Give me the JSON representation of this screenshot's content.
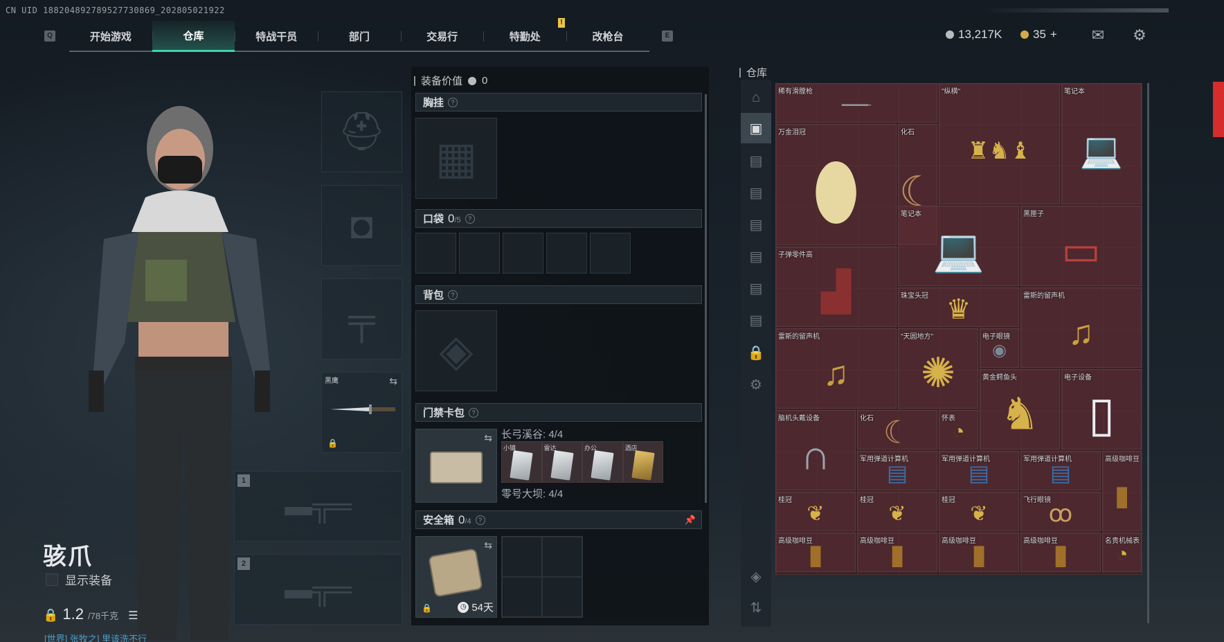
{
  "uid": "CN UID 1882048927895277308​69_202805021922",
  "nav": {
    "left_key": "Q",
    "right_key": "E",
    "tabs": [
      {
        "label": "开始游戏"
      },
      {
        "label": "仓库",
        "active": true
      },
      {
        "label": "特战干员"
      },
      {
        "label": "部门"
      },
      {
        "label": "交易行"
      },
      {
        "label": "特勤处"
      },
      {
        "label": "改枪台"
      }
    ]
  },
  "currency": {
    "coins": "13,217K",
    "bonds": "35",
    "plus": "+"
  },
  "character": {
    "name": "骇爪",
    "show_equipment": "显示装备",
    "weight": "1.2",
    "weight_max": "/78千克",
    "world_chat": "[世界] 张牧之] 里该洗不行"
  },
  "equip_slots": {
    "melee_label": "黑鹰",
    "primary_num": "1",
    "secondary_num": "2"
  },
  "loadout": {
    "value_label": "装备价值",
    "value": "0",
    "chest_rig": "胸挂",
    "pockets": "口袋",
    "pockets_count": "0",
    "pockets_max": "/5",
    "backpack": "背包",
    "keycase": "门禁卡包",
    "keycase_info1": "长弓溪谷: 4/4",
    "keycase_info2": "零号大坝: 4/4",
    "keycards": [
      {
        "label": "小镇"
      },
      {
        "label": "雷达"
      },
      {
        "label": "办公"
      },
      {
        "label": "酒店",
        "gold": true
      }
    ],
    "safebox": "安全箱",
    "safebox_count": "0",
    "safebox_max": "/4",
    "safebox_timer": "54天"
  },
  "storage": {
    "title": "仓库",
    "items": [
      {
        "name": "稀有滑膛枪",
        "icon": "musket"
      },
      {
        "name": "\"纵横\"",
        "icon": "chess"
      },
      {
        "name": "笔记本",
        "icon": "laptop-open"
      },
      {
        "name": "万金泪冠",
        "icon": "egg"
      },
      {
        "name": "化石",
        "icon": "fang"
      },
      {
        "name": "笔记本",
        "icon": "laptop"
      },
      {
        "name": "黑匣子",
        "icon": "blackbox"
      },
      {
        "name": "子弹零件高",
        "icon": "machine"
      },
      {
        "name": "珠宝头冠",
        "icon": "crown"
      },
      {
        "name": "雷斯的留声机",
        "icon": "gramophone"
      },
      {
        "name": "雷斯的留声机",
        "icon": "gramophone"
      },
      {
        "name": "\"天圆地方\"",
        "icon": "armillary"
      },
      {
        "name": "电子眼镜",
        "icon": "goggles"
      },
      {
        "name": "黄金鳄鱼头",
        "icon": "gold-head"
      },
      {
        "name": "电子设备",
        "icon": "jug"
      },
      {
        "name": "脑机头戴设备",
        "icon": "headset"
      },
      {
        "name": "化石",
        "icon": "fang"
      },
      {
        "name": "怀表",
        "icon": "watch"
      },
      {
        "name": "军用弹道计算机",
        "icon": "computer"
      },
      {
        "name": "军用弹道计算机",
        "icon": "computer"
      },
      {
        "name": "军用弹道计算机",
        "icon": "computer"
      },
      {
        "name": "高级咖啡豆",
        "icon": "coffee"
      },
      {
        "name": "桂冠",
        "icon": "laurel"
      },
      {
        "name": "桂冠",
        "icon": "laurel"
      },
      {
        "name": "桂冠",
        "icon": "laurel"
      },
      {
        "name": "飞行眼镜",
        "icon": "sunglasses"
      },
      {
        "name": "高级咖啡豆",
        "icon": "coffee"
      },
      {
        "name": "高级咖啡豆",
        "icon": "coffee"
      },
      {
        "name": "高级咖啡豆",
        "icon": "coffee"
      },
      {
        "name": "高级咖啡豆",
        "icon": "coffee"
      },
      {
        "name": "名贵机械表",
        "icon": "watch"
      }
    ]
  },
  "colors": {
    "accent": "#3ed4b0",
    "grid": "#3b2226",
    "world": "#4f9cc8"
  }
}
